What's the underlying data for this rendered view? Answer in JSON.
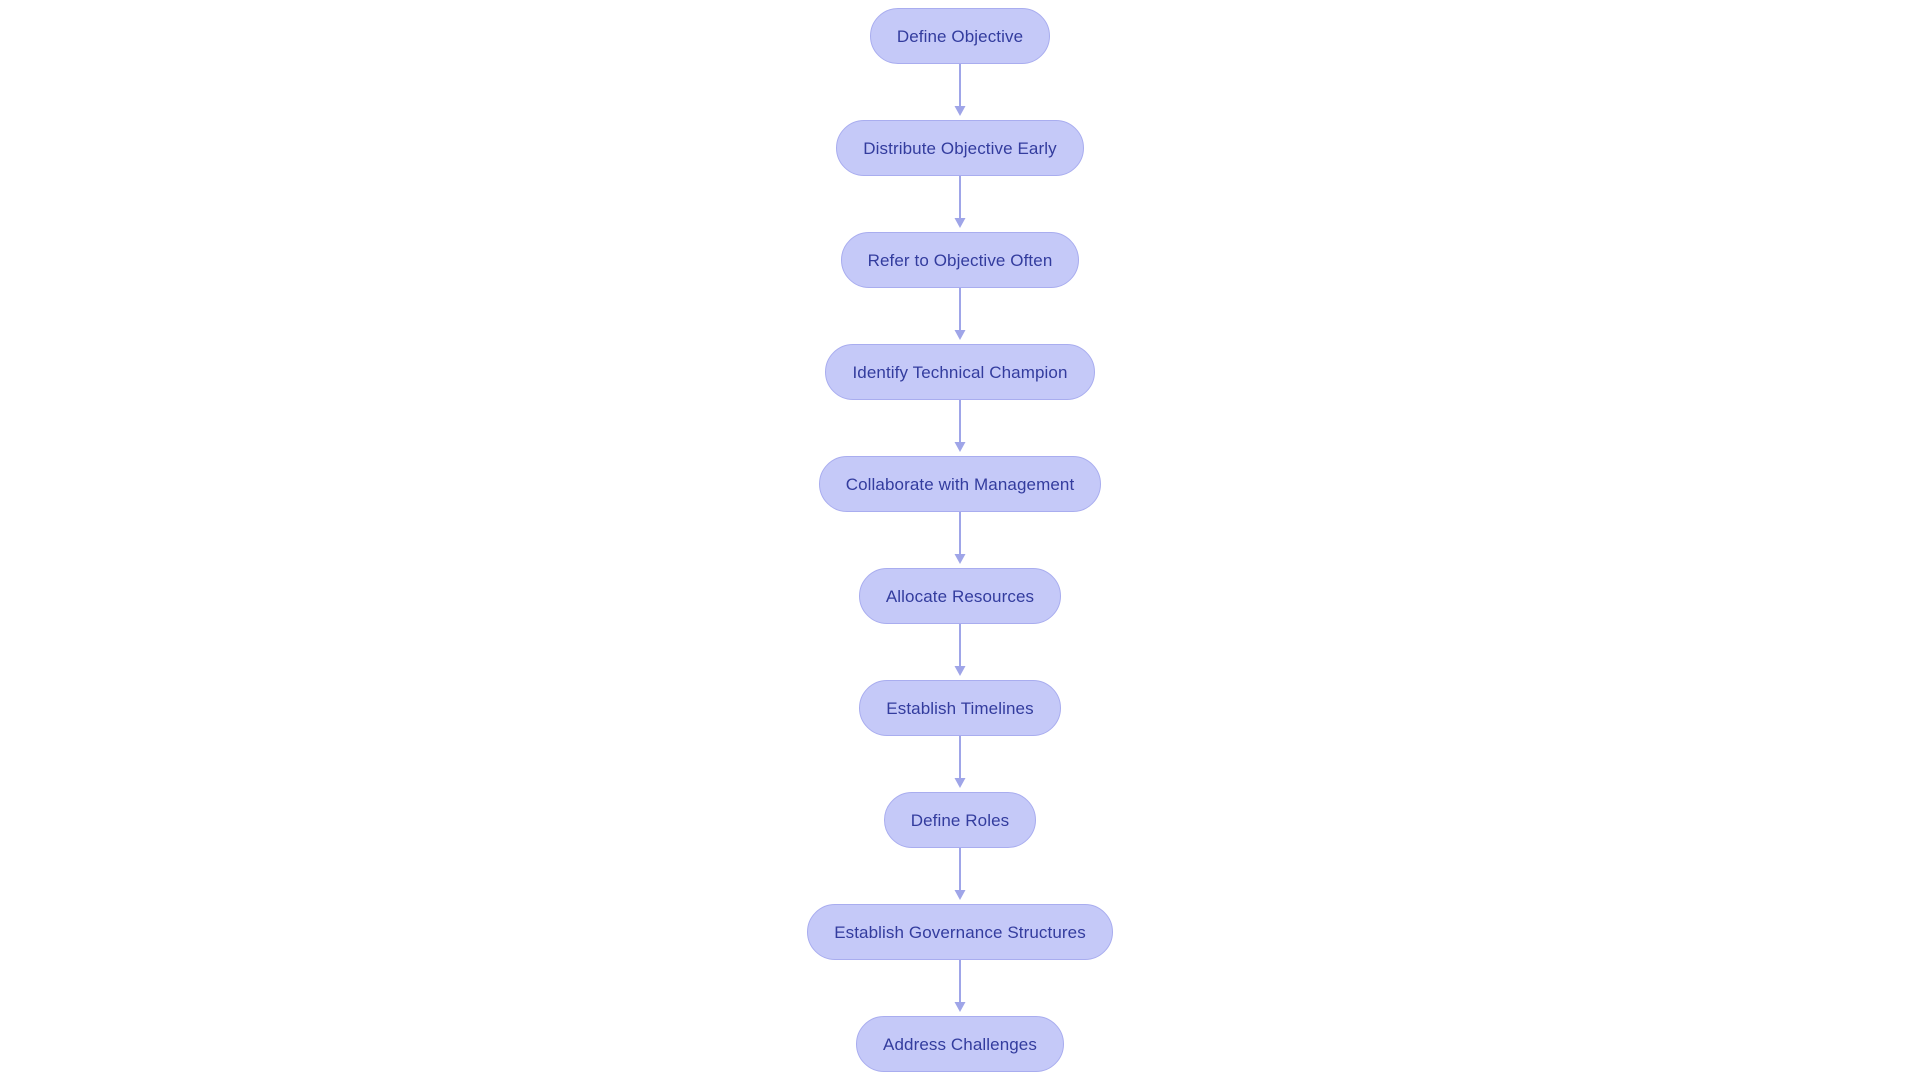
{
  "diagram": {
    "type": "flowchart",
    "orientation": "vertical-top-to-bottom",
    "background_color": "#ffffff",
    "node_fill_color": "#c5c9f8",
    "node_border_color": "#a9adef",
    "node_text_color": "#333c9e",
    "connector_color": "#9fa5e8",
    "node_shape": "rounded-pill",
    "nodes": [
      {
        "id": "n1",
        "label": "Define Objective"
      },
      {
        "id": "n2",
        "label": "Distribute Objective Early"
      },
      {
        "id": "n3",
        "label": "Refer to Objective Often"
      },
      {
        "id": "n4",
        "label": "Identify Technical Champion"
      },
      {
        "id": "n5",
        "label": "Collaborate with Management"
      },
      {
        "id": "n6",
        "label": "Allocate Resources"
      },
      {
        "id": "n7",
        "label": "Establish Timelines"
      },
      {
        "id": "n8",
        "label": "Define Roles"
      },
      {
        "id": "n9",
        "label": "Establish Governance Structures"
      },
      {
        "id": "n10",
        "label": "Address Challenges"
      }
    ],
    "edges": [
      {
        "from": "n1",
        "to": "n2",
        "arrow": "arrow-down-icon"
      },
      {
        "from": "n2",
        "to": "n3",
        "arrow": "arrow-down-icon"
      },
      {
        "from": "n3",
        "to": "n4",
        "arrow": "arrow-down-icon"
      },
      {
        "from": "n4",
        "to": "n5",
        "arrow": "arrow-down-icon"
      },
      {
        "from": "n5",
        "to": "n6",
        "arrow": "arrow-down-icon"
      },
      {
        "from": "n6",
        "to": "n7",
        "arrow": "arrow-down-icon"
      },
      {
        "from": "n7",
        "to": "n8",
        "arrow": "arrow-down-icon"
      },
      {
        "from": "n8",
        "to": "n9",
        "arrow": "arrow-down-icon"
      },
      {
        "from": "n9",
        "to": "n10",
        "arrow": "arrow-down-icon"
      }
    ]
  }
}
